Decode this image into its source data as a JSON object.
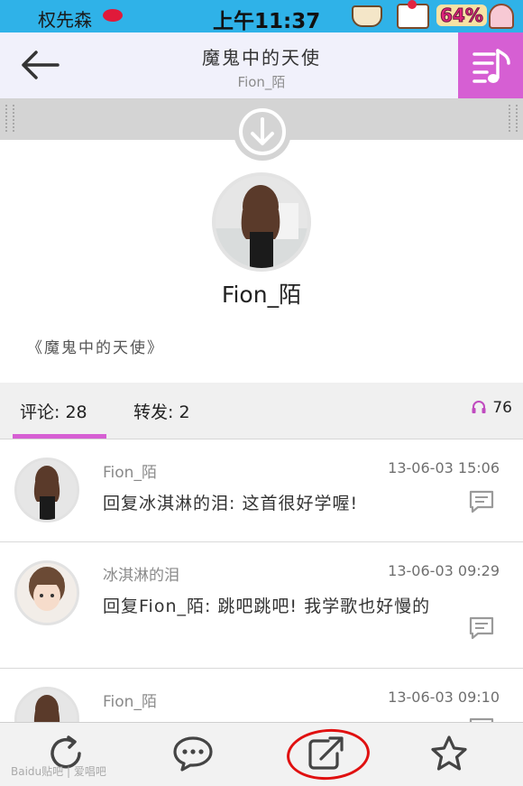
{
  "status_bar": {
    "carrier": "权先森",
    "time": "上午11:37",
    "battery": "64%"
  },
  "header": {
    "title": "魔鬼中的天使",
    "subtitle": "Fion_陌",
    "music_icon": "music-list-icon"
  },
  "profile": {
    "username": "Fion_陌",
    "song_title": "《魔鬼中的天使》"
  },
  "tabs": {
    "comments_label": "评论: 28",
    "forwards_label": "转发: 2",
    "plays": "76"
  },
  "comments": [
    {
      "user": "Fion_陌",
      "time": "13-06-03 15:06",
      "text": "回复冰淇淋的泪: 这首很好学喔!"
    },
    {
      "user": "冰淇淋的泪",
      "time": "13-06-03 09:29",
      "text": "回复Fion_陌: 跳吧跳吧! 我学歌也好慢的"
    },
    {
      "user": "Fion_陌",
      "time": "13-06-03 09:10",
      "text": ""
    }
  ],
  "bottom_bar": {
    "items": [
      "refresh-icon",
      "comment-icon",
      "share-icon",
      "star-icon"
    ]
  },
  "watermark": "Baidu贴吧 | 爱唱吧",
  "colors": {
    "accent": "#d65fd3",
    "status_bar": "#2fb2e8",
    "annotation_circle": "#e01010"
  }
}
